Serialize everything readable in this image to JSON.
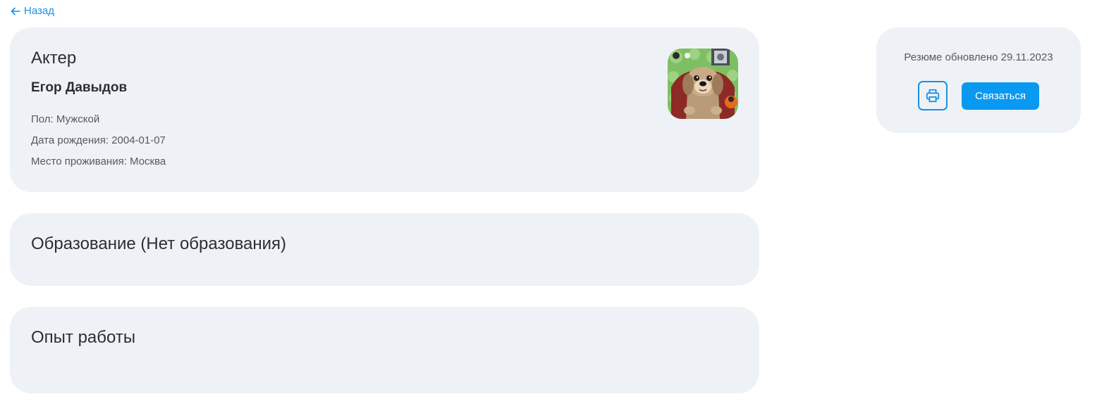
{
  "nav": {
    "back_label": "Назад",
    "back_icon": "arrow-left-icon"
  },
  "profile": {
    "profession": "Актер",
    "name": "Егор Давыдов",
    "gender_label": "Пол",
    "gender_value": "Мужской",
    "birth_label": "Дата рождения",
    "birth_value": "2004-01-07",
    "city_label": "Место проживания",
    "city_value": "Москва",
    "avatar_icon": "avatar-photo"
  },
  "education": {
    "title": "Образование (Нет образования)"
  },
  "experience": {
    "title": "Опыт работы"
  },
  "sidebar": {
    "updated_label": "Резюме обновлено",
    "updated_date": "29.11.2023",
    "print_icon": "printer-icon",
    "contact_label": "Связаться"
  },
  "colors": {
    "accent": "#1a8fe3",
    "button": "#0a99f0",
    "card_background": "#eef2f6",
    "text_primary": "#2b2f33",
    "text_secondary": "#555a60"
  }
}
